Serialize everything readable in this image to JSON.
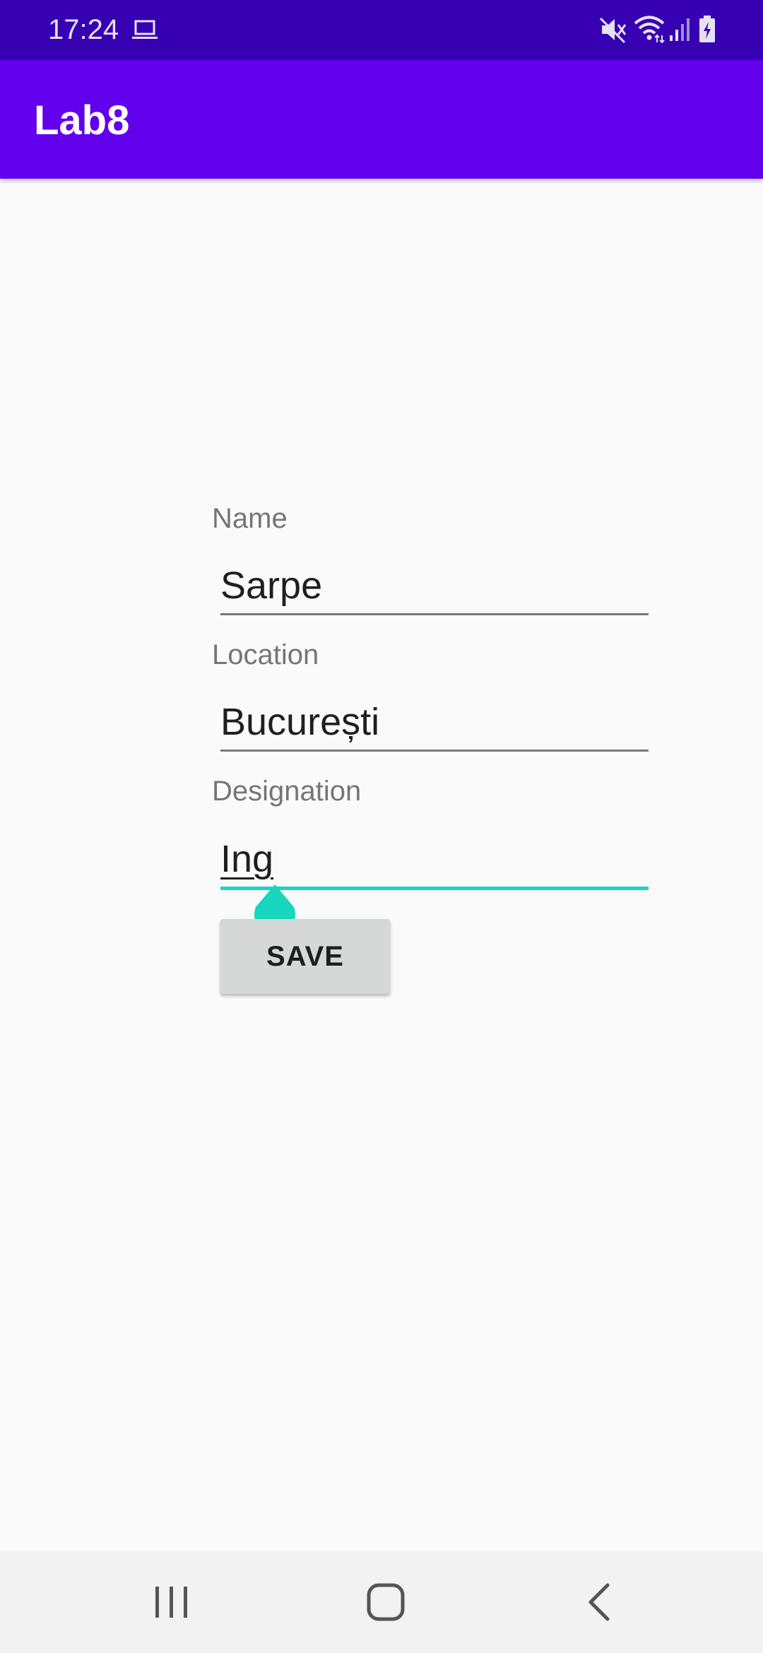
{
  "status_bar": {
    "time": "17:24",
    "icons": [
      "laptop-icon",
      "mute-icon",
      "wifi-icon",
      "signal-icon",
      "battery-icon"
    ]
  },
  "app_bar": {
    "title": "Lab8",
    "color": "#6200ee"
  },
  "form": {
    "name": {
      "label": "Name",
      "value": "Sarpe"
    },
    "location": {
      "label": "Location",
      "value": "București"
    },
    "designation": {
      "label": "Designation",
      "value": "Ing",
      "focused": true
    },
    "save_label": "SAVE",
    "accent_color": "#18d6c0"
  },
  "nav_bar": {
    "icons": [
      "recents-icon",
      "home-icon",
      "back-icon"
    ]
  }
}
